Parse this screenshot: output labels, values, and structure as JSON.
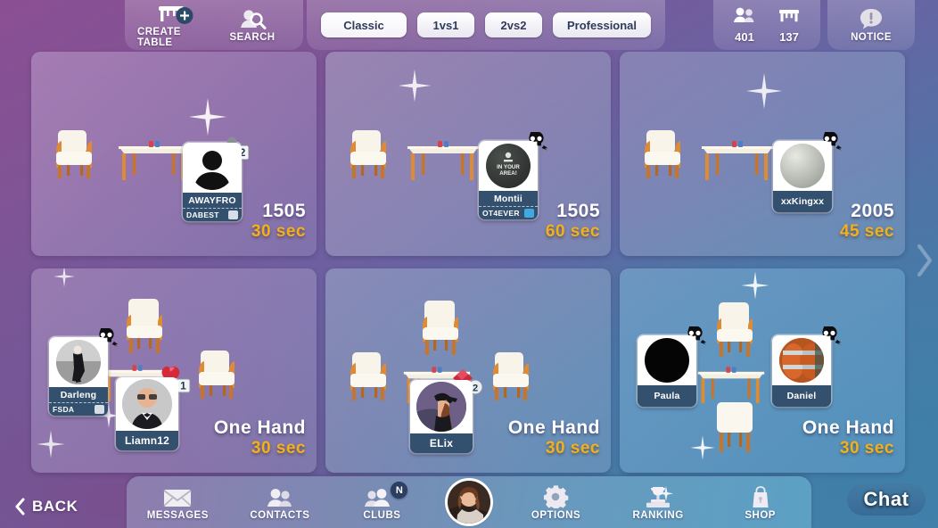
{
  "header": {
    "create_table": {
      "label": "CREATE TABLE",
      "icon": "create-table-icon"
    },
    "search": {
      "label": "SEARCH",
      "icon": "search-icon"
    },
    "filters": [
      {
        "label": "Classic",
        "selected": true
      },
      {
        "label": "1vs1",
        "selected": false
      },
      {
        "label": "2vs2",
        "selected": false
      },
      {
        "label": "Professional",
        "selected": false
      }
    ],
    "counters": [
      {
        "icon": "players-icon",
        "value": "401"
      },
      {
        "icon": "tables-icon",
        "value": "137"
      }
    ],
    "notice": {
      "label": "NOTICE",
      "icon": "notice-icon"
    }
  },
  "tables": [
    {
      "stakes": "1505",
      "timer": "30 sec",
      "seats": [
        {
          "name": "AWAYFRO",
          "club": "DABEST",
          "badge": "club-card",
          "badge_count": "2",
          "avatar": "silhouette-avatar"
        }
      ]
    },
    {
      "stakes": "1505",
      "timer": "60 sec",
      "seats": [
        {
          "name": "Montii",
          "club": "OT4EVER",
          "badge": "skull",
          "badge_count": "",
          "avatar": "in-your-area-avatar"
        }
      ]
    },
    {
      "stakes": "2005",
      "timer": "45 sec",
      "seats": [
        {
          "name": "xxKingxx",
          "club": "",
          "badge": "skull",
          "badge_count": "",
          "avatar": "sphere-avatar"
        }
      ]
    },
    {
      "stakes": "One Hand",
      "timer": "30 sec",
      "seats": [
        {
          "name": "Darleng",
          "club": "FSDA",
          "badge": "skull",
          "badge_count": "",
          "avatar": "dancer-avatar"
        },
        {
          "name": "Liamn12",
          "club": "",
          "badge": "heart-card",
          "badge_count": "1",
          "avatar": "man-glasses-avatar"
        }
      ]
    },
    {
      "stakes": "One Hand",
      "timer": "30 sec",
      "seats": [
        {
          "name": "ELix",
          "club": "",
          "badge": "diamond-card",
          "badge_count": "2",
          "avatar": "woman-cap-avatar"
        }
      ]
    },
    {
      "stakes": "One Hand",
      "timer": "30 sec",
      "seats": [
        {
          "name": "Paula",
          "club": "",
          "badge": "skull",
          "badge_count": "",
          "avatar": "dark-avatar"
        },
        {
          "name": "Daniel",
          "club": "",
          "badge": "skull",
          "badge_count": "",
          "avatar": "orange-avatar"
        }
      ]
    }
  ],
  "footer": {
    "back": {
      "label": "BACK",
      "icon": "chevron-left-icon"
    },
    "nav": [
      {
        "label": "MESSAGES",
        "icon": "envelope-icon",
        "badge": ""
      },
      {
        "label": "CONTACTS",
        "icon": "contacts-icon",
        "badge": ""
      },
      {
        "label": "CLUBS",
        "icon": "clubs-icon",
        "badge": "N"
      },
      {
        "label": "OPTIONS",
        "icon": "gear-icon",
        "badge": ""
      },
      {
        "label": "RANKING",
        "icon": "podium-icon",
        "badge": ""
      },
      {
        "label": "SHOP",
        "icon": "shopping-bag-icon",
        "badge": ""
      }
    ],
    "profile": {
      "icon": "profile-avatar"
    },
    "chat": {
      "label": "Chat"
    }
  },
  "colors": {
    "accent_gold": "#f2b01e",
    "seat_navy": "#33516e",
    "badge_navy": "#2c3f63"
  }
}
